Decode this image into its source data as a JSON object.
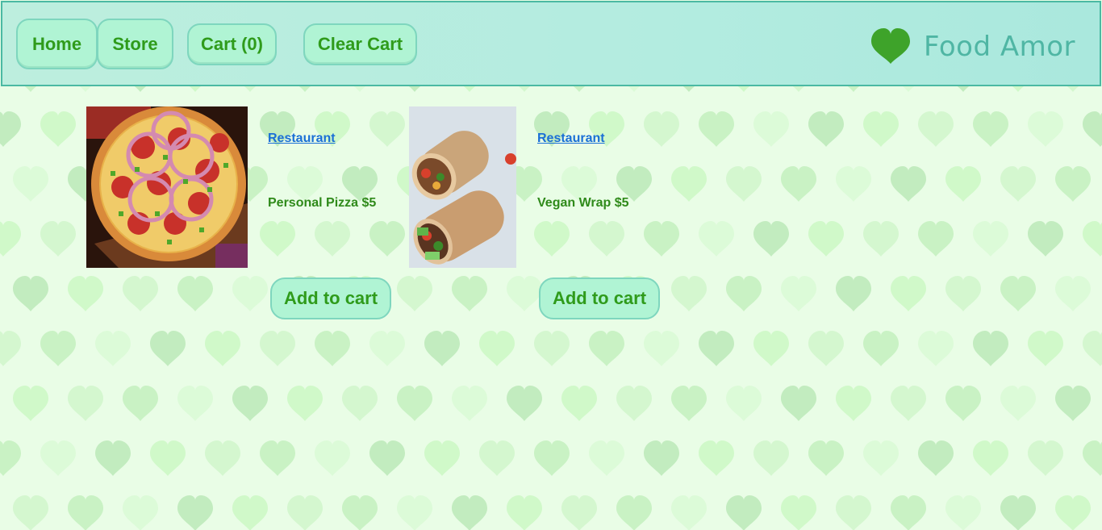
{
  "nav": {
    "home_label": "Home",
    "store_label": "Store",
    "cart_label": "Cart (0)",
    "clear_cart_label": "Clear Cart"
  },
  "logo": {
    "text": "Food Amor",
    "icon": "heart-icon"
  },
  "products": [
    {
      "image": "pizza-image",
      "restaurant_link": "Restaurant",
      "name_price": "Personal Pizza $5",
      "add_label": "Add to cart"
    },
    {
      "image": "wrap-image",
      "restaurant_link": "Restaurant",
      "name_price": "Vegan Wrap $5",
      "add_label": "Add to cart"
    }
  ],
  "colors": {
    "background": "#e9fde6",
    "header_border": "#4bb9a3",
    "button_bg": "#b0f4d4",
    "button_text": "#2f9b1b",
    "link": "#1a6fd6",
    "logo_heart": "#3ea32a",
    "logo_text": "#4fb6a4"
  }
}
